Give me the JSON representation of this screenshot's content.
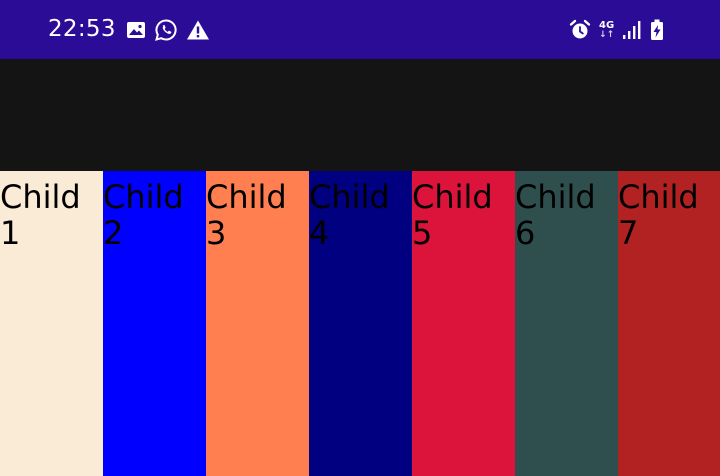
{
  "status_bar": {
    "time": "22:53",
    "network_label": "4G",
    "network_arrows": "↓↑",
    "background_color": "#2b0c96",
    "left_icons": [
      "image-icon",
      "whatsapp-icon",
      "warning-icon"
    ],
    "right_icons": [
      "alarm-icon",
      "network-4g-icon",
      "signal-icon",
      "battery-charging-icon"
    ]
  },
  "app_bar": {
    "background_color": "#141414"
  },
  "children": [
    {
      "label": "Child 1",
      "color": "#faebd7"
    },
    {
      "label": "Child 2",
      "color": "#0000ff"
    },
    {
      "label": "Child 3",
      "color": "#ff7f50"
    },
    {
      "label": "Child 4",
      "color": "#000080"
    },
    {
      "label": "Child 5",
      "color": "#dc143c"
    },
    {
      "label": "Child 6",
      "color": "#2f4f4f"
    },
    {
      "label": "Child 7",
      "color": "#b22222"
    }
  ]
}
